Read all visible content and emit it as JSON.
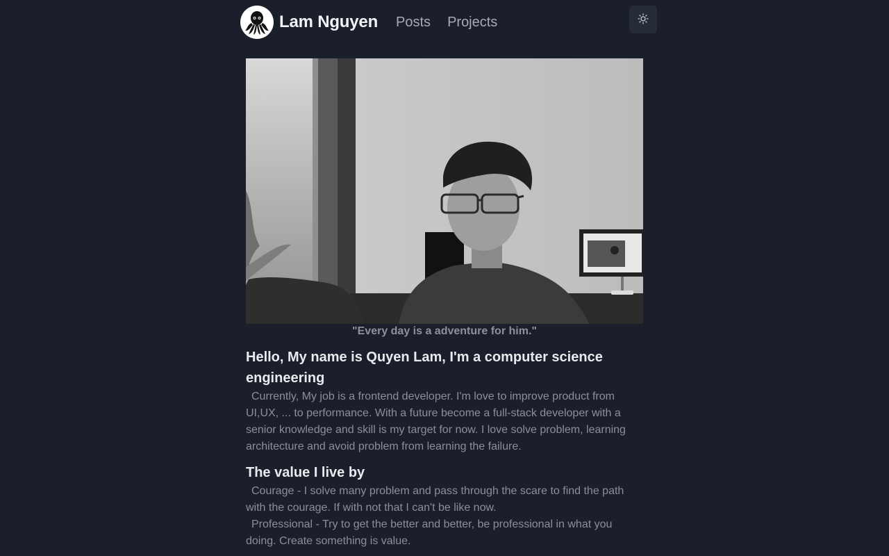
{
  "header": {
    "brand": "Lam Nguyen",
    "nav": [
      "Posts",
      "Projects"
    ],
    "logo_icon": "octopus-icon",
    "theme_icon": "sun-icon"
  },
  "hero": {
    "caption": "\"Every day is a adventure for him.\""
  },
  "about": {
    "heading": "Hello, My name is Quyen Lam, I'm a computer science engineering",
    "body": "Currently, My job is a frontend developer. I'm love to improve product from UI,UX, ... to performance. With a future become a full-stack developer with a senior knowledge and skill is my target for now. I love solve problem, learning architecture and avoid problem from learning the failure."
  },
  "values": {
    "heading": "The value I live by",
    "items": [
      "Courage - I solve many problem and pass through the scare to find the path with the courage. If with not that I can't be like now.",
      "Professional - Try to get the better and better, be professional in what you doing. Create something is value."
    ]
  },
  "colors": {
    "background": "#1b1f2b",
    "heading": "#e9eaed",
    "muted": "#8b8f98",
    "button_bg": "#262b38"
  }
}
